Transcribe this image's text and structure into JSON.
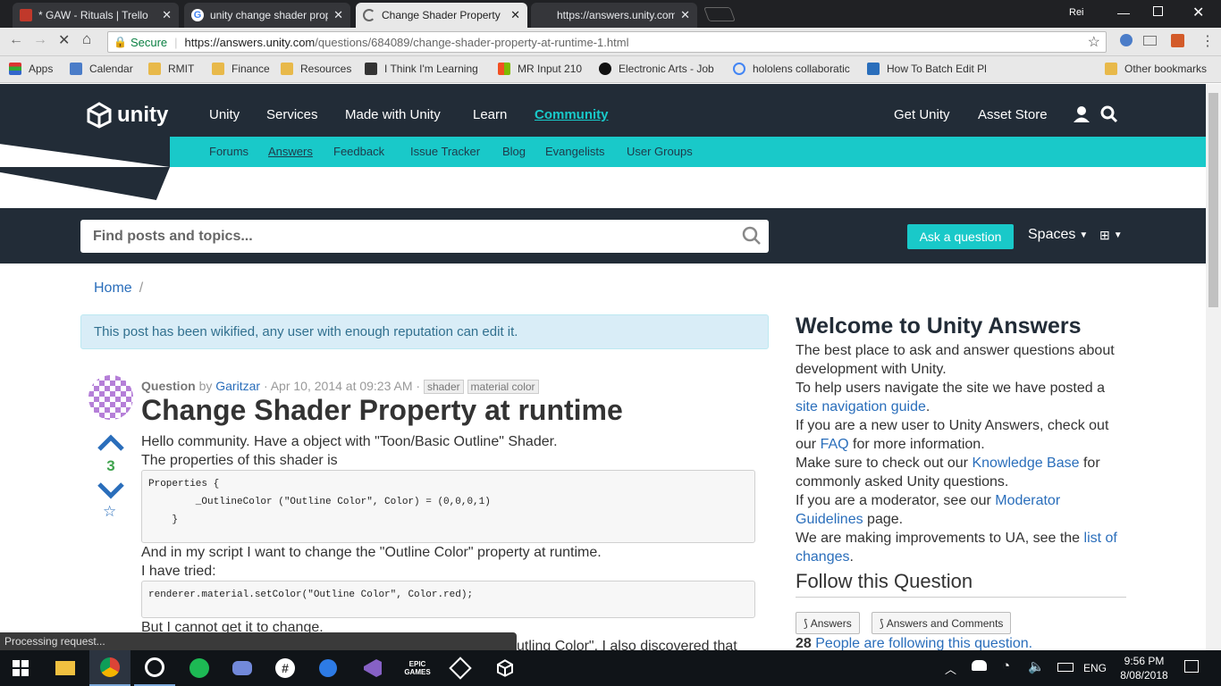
{
  "browser": {
    "tabs": [
      {
        "title": "* GAW - Rituals | Trello",
        "active": false,
        "color": "#c0392b"
      },
      {
        "title": "unity change shader prop",
        "active": false,
        "color": "#4285f4"
      },
      {
        "title": "Change Shader Property",
        "active": true,
        "color": "#888888"
      },
      {
        "title": "https://answers.unity.com",
        "active": false,
        "color": "#888888"
      }
    ],
    "profile": "Rei",
    "secure_label": "Secure",
    "url_host": "https://answers.unity.com",
    "url_path": "/questions/684089/change-shader-property-at-runtime-1.html",
    "bookmarks": [
      {
        "label": "Apps",
        "icon": "apps-icon"
      },
      {
        "label": "Calendar",
        "icon": "calendar-icon"
      },
      {
        "label": "RMIT",
        "icon": "folder-icon"
      },
      {
        "label": "Finance",
        "icon": "folder-icon"
      },
      {
        "label": "Resources",
        "icon": "folder-icon"
      },
      {
        "label": "I Think I'm Learning",
        "icon": "page-icon"
      },
      {
        "label": "MR Input 210",
        "icon": "windows-icon"
      },
      {
        "label": "Electronic Arts - Job",
        "icon": "ea-icon"
      },
      {
        "label": "hololens collaboratic",
        "icon": "google-icon"
      },
      {
        "label": "How To Batch Edit Pl",
        "icon": "plus-icon"
      }
    ],
    "other_bookmarks": "Other bookmarks",
    "status_text": "Processing request..."
  },
  "site": {
    "logo_text": "unity",
    "nav": [
      "Unity",
      "Services",
      "Made with Unity",
      "Learn",
      "Community"
    ],
    "nav_right": [
      "Get Unity",
      "Asset Store"
    ],
    "subnav": [
      "Forums",
      "Answers",
      "Feedback",
      "Issue Tracker",
      "Blog",
      "Evangelists",
      "User Groups"
    ],
    "search_placeholder": "Find posts and topics...",
    "ask_button": "Ask a question",
    "spaces": "Spaces",
    "breadcrumb_home": "Home",
    "breadcrumb_sep": "/",
    "notice": "This post has been wikified, any user with enough reputation can edit it."
  },
  "question": {
    "meta_label": "Question",
    "meta_by": "by",
    "author": "Garitzar",
    "date": "· Apr 10, 2014 at 09:23 AM ·",
    "tags": [
      "shader",
      "material color"
    ],
    "title": "Change Shader Property at runtime",
    "votes": "3",
    "body1": "Hello community. Have a object with \"Toon/Basic Outline\" Shader.",
    "body2": "The properties of this shader is",
    "code1": "Properties {\n        _OutlineColor (\"Outline Color\", Color) = (0,0,0,1)\n    }",
    "body3": "And in my script I want to change the \"Outline Color\" property at runtime.",
    "body4": "I have tried:",
    "code2": "renderer.material.setColor(\"Outline Color\", Color.red);",
    "body5": "But I cannot get it to change.",
    "body6": "utling Color\". I also discovered that"
  },
  "sidebar": {
    "welcome_title": "Welcome to Unity Answers",
    "p1": "The best place to ask and answer questions about development with Unity.",
    "p2a": "To help users navigate the site we have posted a ",
    "p2link": "site navigation guide",
    "p2b": ".",
    "p3a": "If you are a new user to Unity Answers, check out our ",
    "p3link": "FAQ",
    "p3b": " for more information.",
    "p4a": "Make sure to check out our ",
    "p4link": "Knowledge Base",
    "p4b": " for commonly asked Unity questions.",
    "p5a": "If you are a moderator, see our ",
    "p5link": "Moderator Guidelines",
    "p5b": " page.",
    "p6a": "We are making improvements to UA, see the ",
    "p6link": "list of changes",
    "p6b": ".",
    "follow_title": "Follow this Question",
    "btn_answers": "Answers",
    "btn_answers_comments": "Answers and Comments",
    "followers_count": "28",
    "followers_text": "People are following this question."
  },
  "taskbar": {
    "time": "9:56 PM",
    "date": "8/08/2018",
    "lang": "ENG"
  },
  "colors": {
    "unity_dark": "#222c37",
    "unity_teal": "#19c9c9",
    "link": "#2a6ebb"
  }
}
